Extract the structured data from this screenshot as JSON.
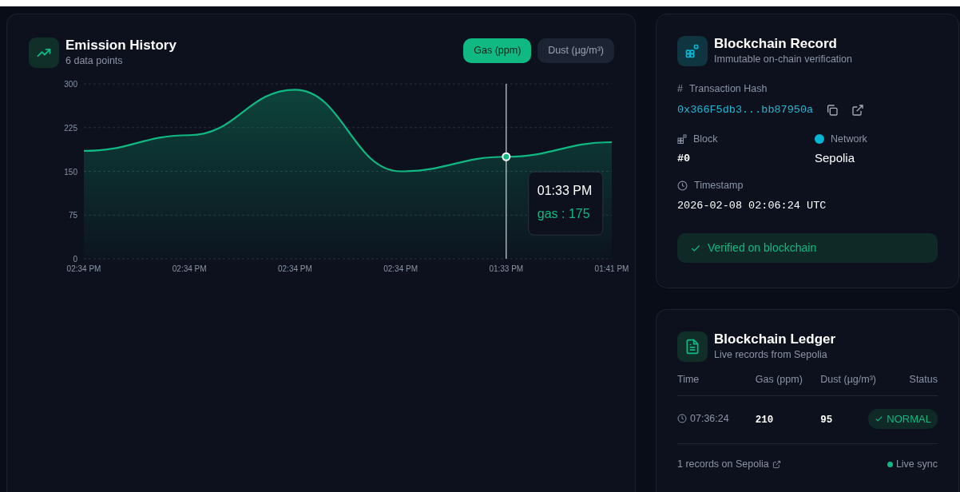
{
  "emission": {
    "title": "Emission History",
    "subtitle": "6 data points",
    "toggles": [
      {
        "label": "Gas (ppm)",
        "selected": true
      },
      {
        "label": "Dust (µg/m³)",
        "selected": false
      }
    ],
    "chart_data": {
      "type": "area",
      "categories": [
        "02:34 PM",
        "02:34 PM",
        "02:34 PM",
        "02:34 PM",
        "01:33 PM",
        "01:41 PM"
      ],
      "series": [
        {
          "color": "#10b981",
          "values": [
            185,
            212,
            290,
            150,
            175,
            200
          ]
        }
      ],
      "ylim": [
        0,
        300
      ],
      "yticks": [
        0,
        75,
        150,
        225,
        300
      ],
      "grid": true,
      "ref_lines": [
        {
          "axis": "x",
          "value": "01:33 PM"
        }
      ]
    },
    "tooltip": {
      "title": "01:33 PM",
      "text": "gas : 175"
    }
  },
  "record": {
    "title": "Blockchain Record",
    "subtitle": "Immutable on-chain verification",
    "hash_icon": "#",
    "hash_label": "Transaction Hash",
    "hash": "0x366F5db3...bb87950a",
    "block_label": "Block",
    "block": "#0",
    "network_label": "Network",
    "network": "Sepolia",
    "timestamp_label": "Timestamp",
    "timestamp": "2026-02-08 02:06:24 UTC",
    "verified": "Verified on blockchain"
  },
  "ledger": {
    "title": "Blockchain Ledger",
    "subtitle": "Live records from Sepolia",
    "columns": [
      "Time",
      "Gas (ppm)",
      "Dust (µg/m³)",
      "Status"
    ],
    "rows": [
      {
        "time": "07:36:24",
        "gas": "210",
        "dust": "95",
        "status": "NORMAL"
      }
    ],
    "footer": "1 records on Sepolia",
    "sync": "Live sync"
  }
}
